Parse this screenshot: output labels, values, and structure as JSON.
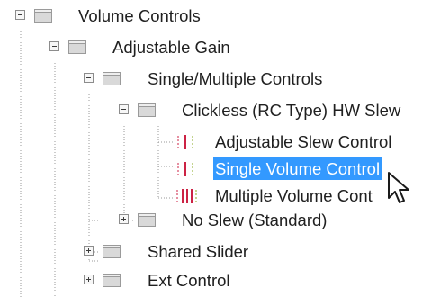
{
  "tree": {
    "nodes": [
      {
        "label": "Volume Controls",
        "state": "expanded",
        "icon": "folder-icon"
      },
      {
        "label": "Adjustable Gain",
        "state": "expanded",
        "icon": "folder-icon"
      },
      {
        "label": "Single/Multiple Controls",
        "state": "expanded",
        "icon": "folder-icon"
      },
      {
        "label": "Clickless (RC Type) HW Slew",
        "state": "expanded",
        "icon": "folder-icon"
      },
      {
        "label": "Adjustable Slew Control",
        "state": "leaf",
        "icon": "single-slider-icon"
      },
      {
        "label": "Single Volume Control",
        "state": "leaf",
        "icon": "single-slider-icon",
        "selected": true
      },
      {
        "label": "Multiple Volume Cont",
        "state": "leaf",
        "icon": "multi-slider-icon"
      },
      {
        "label": "No Slew (Standard)",
        "state": "collapsed",
        "icon": "folder-icon"
      },
      {
        "label": "Shared Slider",
        "state": "collapsed",
        "icon": "folder-icon"
      },
      {
        "label": "Ext Control",
        "state": "collapsed",
        "icon": "folder-icon"
      }
    ]
  },
  "colors": {
    "selection": "#3399ff",
    "folder": "#d9d9d9",
    "slider_red": "#cc2244",
    "guide_line": "#9a9a9a"
  }
}
